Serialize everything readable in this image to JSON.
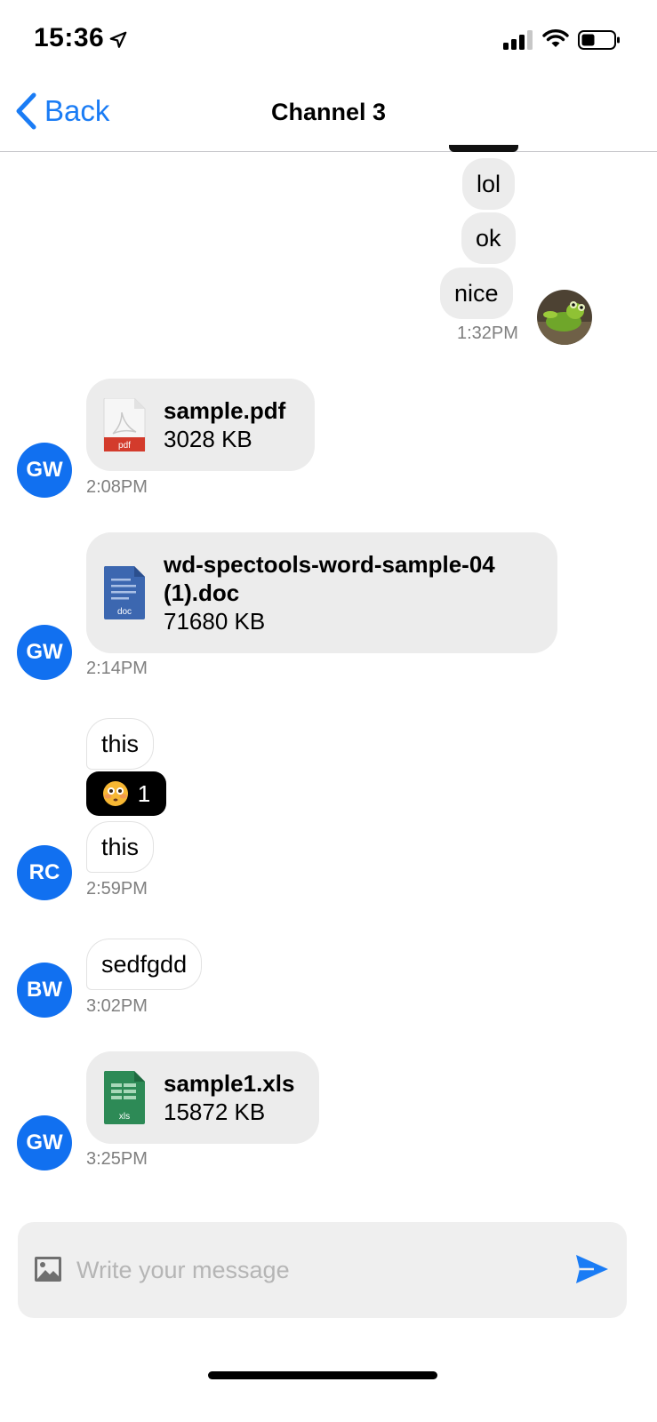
{
  "status": {
    "time": "15:36"
  },
  "nav": {
    "back_label": "Back",
    "title": "Channel 3"
  },
  "colors": {
    "accent": "#1a7cf5",
    "avatar": "#1170f0",
    "bubble_gray": "#ececec",
    "pdf_red": "#d33b2c",
    "doc_blue": "#3c67b0",
    "xls_green": "#2d8a56"
  },
  "messages": {
    "out": [
      {
        "text": "lol"
      },
      {
        "text": "ok"
      },
      {
        "text": "nice"
      }
    ],
    "out_time": "1:32PM",
    "pdf": {
      "avatar": "GW",
      "name": "sample.pdf",
      "size": "3028 KB",
      "type": "pdf",
      "time": "2:08PM"
    },
    "doc": {
      "avatar": "GW",
      "name_line1": "wd-spectools-word-sample-04",
      "name_line2": "(1).doc",
      "size": "71680 KB",
      "type": "doc",
      "time": "2:14PM"
    },
    "rc": {
      "avatar": "RC",
      "text1": "this",
      "reaction_count": "1",
      "reaction_icon": "flushed-face-emoji",
      "text2": "this",
      "time": "2:59PM"
    },
    "bw": {
      "avatar": "BW",
      "text": "sedfgdd",
      "time": "3:02PM"
    },
    "xls": {
      "avatar": "GW",
      "name": "sample1.xls",
      "size": "15872 KB",
      "type": "xls",
      "time": "3:25PM"
    }
  },
  "composer": {
    "placeholder": "Write your message"
  }
}
